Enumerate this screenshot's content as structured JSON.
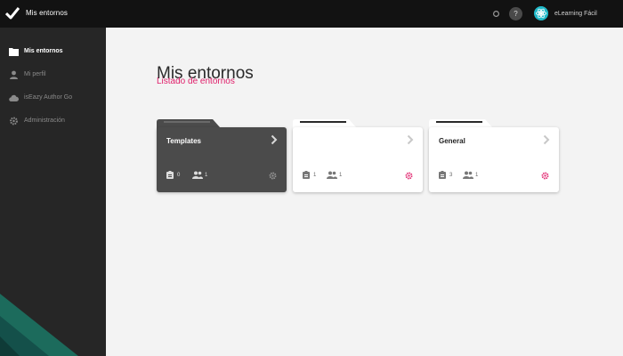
{
  "app": {
    "title": "Mis entornos",
    "user_name": "eLearning Fácil",
    "help_label": "?"
  },
  "sidebar": {
    "items": [
      {
        "label": "Mis entornos",
        "icon": "folder-icon",
        "active": true
      },
      {
        "label": "Mi perfil",
        "icon": "user-icon",
        "active": false
      },
      {
        "label": "isEazy Author Go",
        "icon": "cloud-icon",
        "active": false
      },
      {
        "label": "Administración",
        "icon": "gear-icon",
        "active": false
      }
    ]
  },
  "main": {
    "title": "Mis entornos",
    "subtitle": "Listado de entornos",
    "environments": [
      {
        "name": "Templates",
        "courses": "0",
        "users": "1",
        "style": "dark"
      },
      {
        "name": "",
        "courses": "1",
        "users": "1",
        "style": "light"
      },
      {
        "name": "General",
        "courses": "3",
        "users": "1",
        "style": "light"
      }
    ]
  },
  "colors": {
    "accent": "#e0206b",
    "topbar": "#121212",
    "sidebar": "#262626",
    "avatar": "#1fb8c8",
    "deco": "#1c6b5c"
  }
}
